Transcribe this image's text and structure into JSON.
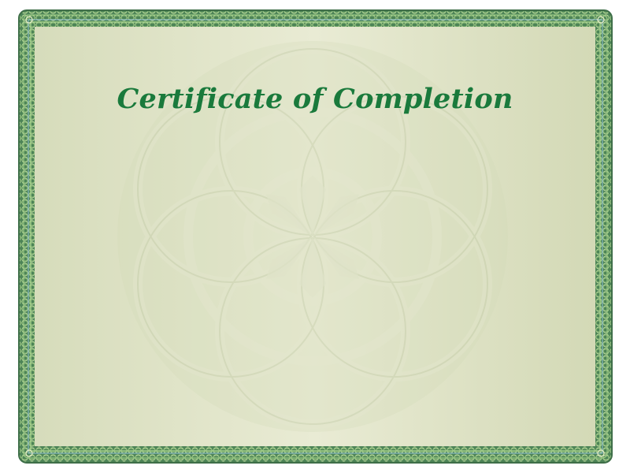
{
  "certificate": {
    "title": "Certificate of Completion",
    "title_color": "#1a7a3c"
  },
  "colors": {
    "border_outer": "#4a7f54",
    "border_inner": "#a7c98f",
    "paper_left": "#d6dcbb",
    "paper_center": "#e9ebd4",
    "paper_right": "#d3d9b6",
    "guilloche": "#c4ccaa"
  },
  "decorations": {
    "center_emblem": "rosette-guilloche",
    "border_pattern": "guilloche-wave-border"
  }
}
